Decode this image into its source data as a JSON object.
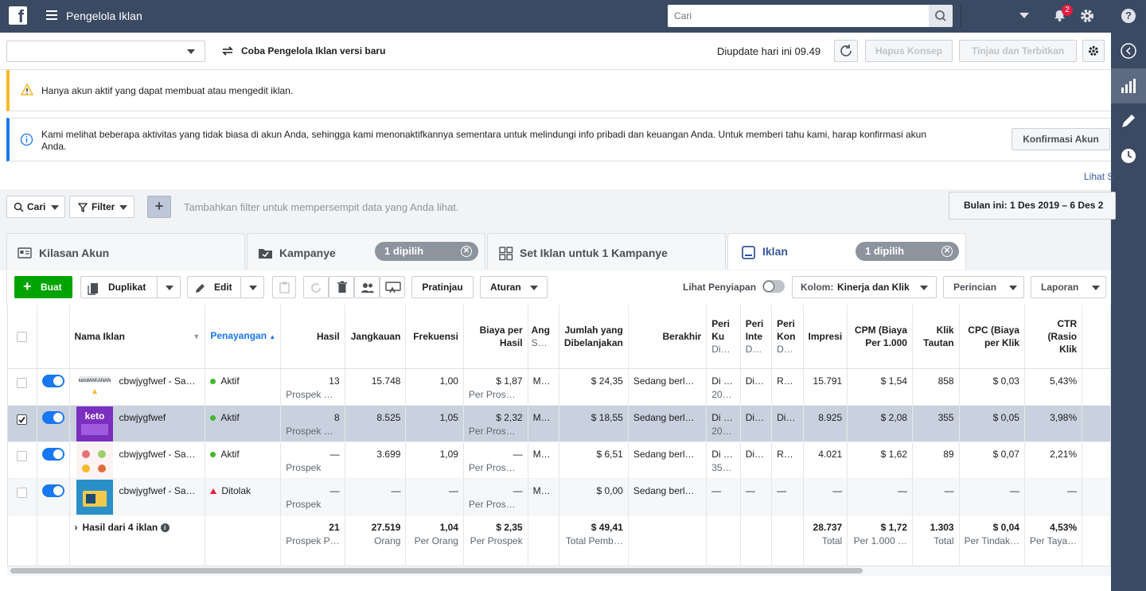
{
  "topbar": {
    "title": "Pengelola Iklan",
    "search_placeholder": "Cari",
    "notif_count": "2"
  },
  "toolbar": {
    "try_new": "Coba Pengelola Iklan versi baru",
    "updated": "Diupdate hari ini 09.49",
    "discard": "Hapus Konsep",
    "review": "Tinjau dan Terbitkan"
  },
  "banners": {
    "warning": "Hanya akun aktif yang dapat membuat atau mengedit iklan.",
    "info_line1": "Kami melihat beberapa aktivitas yang tidak biasa di akun Anda, sehingga kami menonaktifkannya sementara untuk melindungi info pribadi dan keuangan Anda. Untuk memberi tahu kami, harap konfirmasi akun",
    "info_line2": "Anda.",
    "confirm_button": "Konfirmasi Akun",
    "see_link": "Lihat S"
  },
  "filters": {
    "search": "Cari",
    "filter": "Filter",
    "add": "+",
    "placeholder": "Tambahkan filter untuk mempersempit data yang Anda lihat.",
    "date_range": "Bulan ini: 1 Des 2019 – 6 Des 2"
  },
  "tabs": {
    "account": "Kilasan Akun",
    "campaigns": "Kampanye",
    "campaigns_pill": "1 dipilih",
    "adsets": "Set Iklan untuk 1 Kampanye",
    "ads": "Iklan",
    "ads_pill": "1 dipilih"
  },
  "actions": {
    "create": "Buat",
    "duplicate": "Duplikat",
    "edit": "Edit",
    "preview": "Pratinjau",
    "rules": "Aturan",
    "view_setup": "Lihat Penyiapan",
    "columns_label": "Kolom:",
    "columns_value": "Kinerja dan Klik",
    "breakdown": "Perincian",
    "reports": "Laporan"
  },
  "columns": {
    "name": "Nama Iklan",
    "delivery": "Penayangan",
    "results": "Hasil",
    "reach": "Jangkauan",
    "frequency": "Frekuensi",
    "cost_per_result": "Biaya per Hasil",
    "budget": "Ang",
    "budget_sub": "S…",
    "amount_spent": "Jumlah yang Dibelanjakan",
    "ends": "Berakhir",
    "c1": "Peri Ku",
    "c1_sub": "Di…",
    "c2": "Peri Inte",
    "c2_sub": "D…",
    "c3": "Peri Kon",
    "c3_sub": "D…",
    "impressions": "Impresi",
    "cpm": "CPM (Biaya Per 1.000",
    "link_clicks": "Klik Tautan",
    "cpc": "CPC (Biaya per Klik",
    "ctr": "CTR (Rasio Klik"
  },
  "rows": [
    {
      "name": "cbwjygfwef - Sa…",
      "status": "Aktif",
      "results": "13",
      "results_sub": "Prospek …",
      "reach": "15.748",
      "freq": "1,00",
      "cpr": "$ 1,87",
      "cpr_sub": "Per Pros…",
      "budget": "M…",
      "spent": "$ 24,35",
      "ends": "Sedang berl…",
      "c1": "Di …",
      "c1_sub": "20…",
      "c2": "Di…",
      "c3": "R…",
      "impr": "15.791",
      "cpm": "$ 1,54",
      "clicks": "858",
      "cpc": "$ 0,03",
      "ctr": "5,43%",
      "checked": false
    },
    {
      "name": "cbwjygfwef",
      "status": "Aktif",
      "results": "8",
      "results_sub": "Prospek …",
      "reach": "8.525",
      "freq": "1,05",
      "cpr": "$ 2,32",
      "cpr_sub": "Per Pros…",
      "budget": "M…",
      "spent": "$ 18,55",
      "ends": "Sedang berl…",
      "c1": "Di …",
      "c1_sub": "20…",
      "c2": "Di…",
      "c3": "Di…",
      "impr": "8.925",
      "cpm": "$ 2,08",
      "clicks": "355",
      "cpc": "$ 0,05",
      "ctr": "3,98%",
      "checked": true
    },
    {
      "name": "cbwjygfwef - Sa…",
      "status": "Aktif",
      "results": "—",
      "results_sub": "Prospek",
      "reach": "3.699",
      "freq": "1,09",
      "cpr": "—",
      "cpr_sub": "Per Pros…",
      "budget": "M…",
      "spent": "$ 6,51",
      "ends": "Sedang berl…",
      "c1": "Di …",
      "c1_sub": "35…",
      "c2": "Di…",
      "c3": "R…",
      "impr": "4.021",
      "cpm": "$ 1,62",
      "clicks": "89",
      "cpc": "$ 0,07",
      "ctr": "2,21%",
      "checked": false
    },
    {
      "name": "cbwjygfwef - Sa…",
      "status": "Ditolak",
      "results": "—",
      "results_sub": "Prospek",
      "reach": "—",
      "freq": "—",
      "cpr": "—",
      "cpr_sub": "Per Pros…",
      "budget": "M…",
      "spent": "$ 0,00",
      "ends": "Sedang berl…",
      "c1": "—",
      "c1_sub": "",
      "c2": "—",
      "c3": "—",
      "impr": "—",
      "cpm": "—",
      "clicks": "—",
      "cpc": "—",
      "ctr": "—",
      "checked": false
    }
  ],
  "totals": {
    "label": "Hasil dari 4 iklan",
    "results": "21",
    "results_sub": "Prospek P…",
    "reach": "27.519",
    "reach_sub": "Orang",
    "freq": "1,04",
    "freq_sub": "Per Orang",
    "cpr": "$ 2,35",
    "cpr_sub": "Per Prospek",
    "spent": "$ 49,41",
    "spent_sub": "Total Pemb…",
    "impr": "28.737",
    "impr_sub": "Total",
    "cpm": "$ 1,72",
    "cpm_sub": "Per 1.000 …",
    "clicks": "1.303",
    "clicks_sub": "Total",
    "cpc": "$ 0,04",
    "cpc_sub": "Per Tindak…",
    "ctr": "4,53%",
    "ctr_sub": "Per Taya…"
  },
  "thumb_text": {
    "row1": "ketoMAKANAN",
    "row2": "keto"
  },
  "colors": {
    "topbar": "#3b4a63",
    "accent": "#1877f2",
    "create": "#00a400",
    "active": "#42b72a",
    "rejected": "#e41e3f",
    "warning": "#f7b928"
  }
}
